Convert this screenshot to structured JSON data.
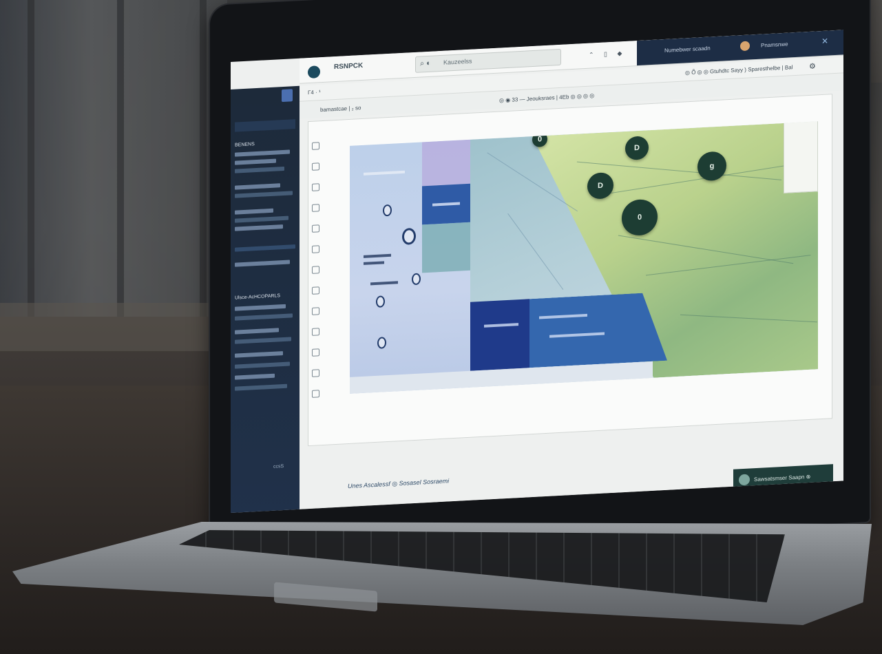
{
  "app": {
    "brand": "RSNPCK",
    "search_text": "Kauzeelss",
    "panel_left": "Numebwer scaadn",
    "panel_right": "Pnamsnwe",
    "nav_left": "Γ4 · ¹",
    "nav_right": "◎ Ȫ ◎ ◎ Gtuhdtc Sayy ) Sparesthelbe | Bal",
    "toolbar_left": "bamastcae | ₂ so",
    "toolbar_right": "◎ ◉ 33 — Jeouksraes | 4Eb ◎ ◎ ◎ ◎"
  },
  "sidebar": {
    "footer": "ccsS",
    "texts": [
      "BENENS",
      "Ulsce-AcHCOPARLS"
    ]
  },
  "map": {
    "markers": [
      "0",
      "D",
      "D",
      "g",
      "0"
    ],
    "card_lines": [
      "—",
      "—"
    ]
  },
  "footer": {
    "brand_text": "Unes Ascalessf ◎ Sosasel Sosraemi",
    "button_text": "Sawsatsmser Saapn ⊗"
  },
  "colors": {
    "sidebar": "#1d2a3a",
    "panel": "#1d2d45",
    "map_green": "#b9d18c",
    "map_navy": "#1f3a8a",
    "marker": "#1d3d33",
    "footer_button": "#1f3d3a"
  },
  "icons": [
    "search-icon",
    "settings-icon",
    "close-icon",
    "location-pin-icon"
  ]
}
